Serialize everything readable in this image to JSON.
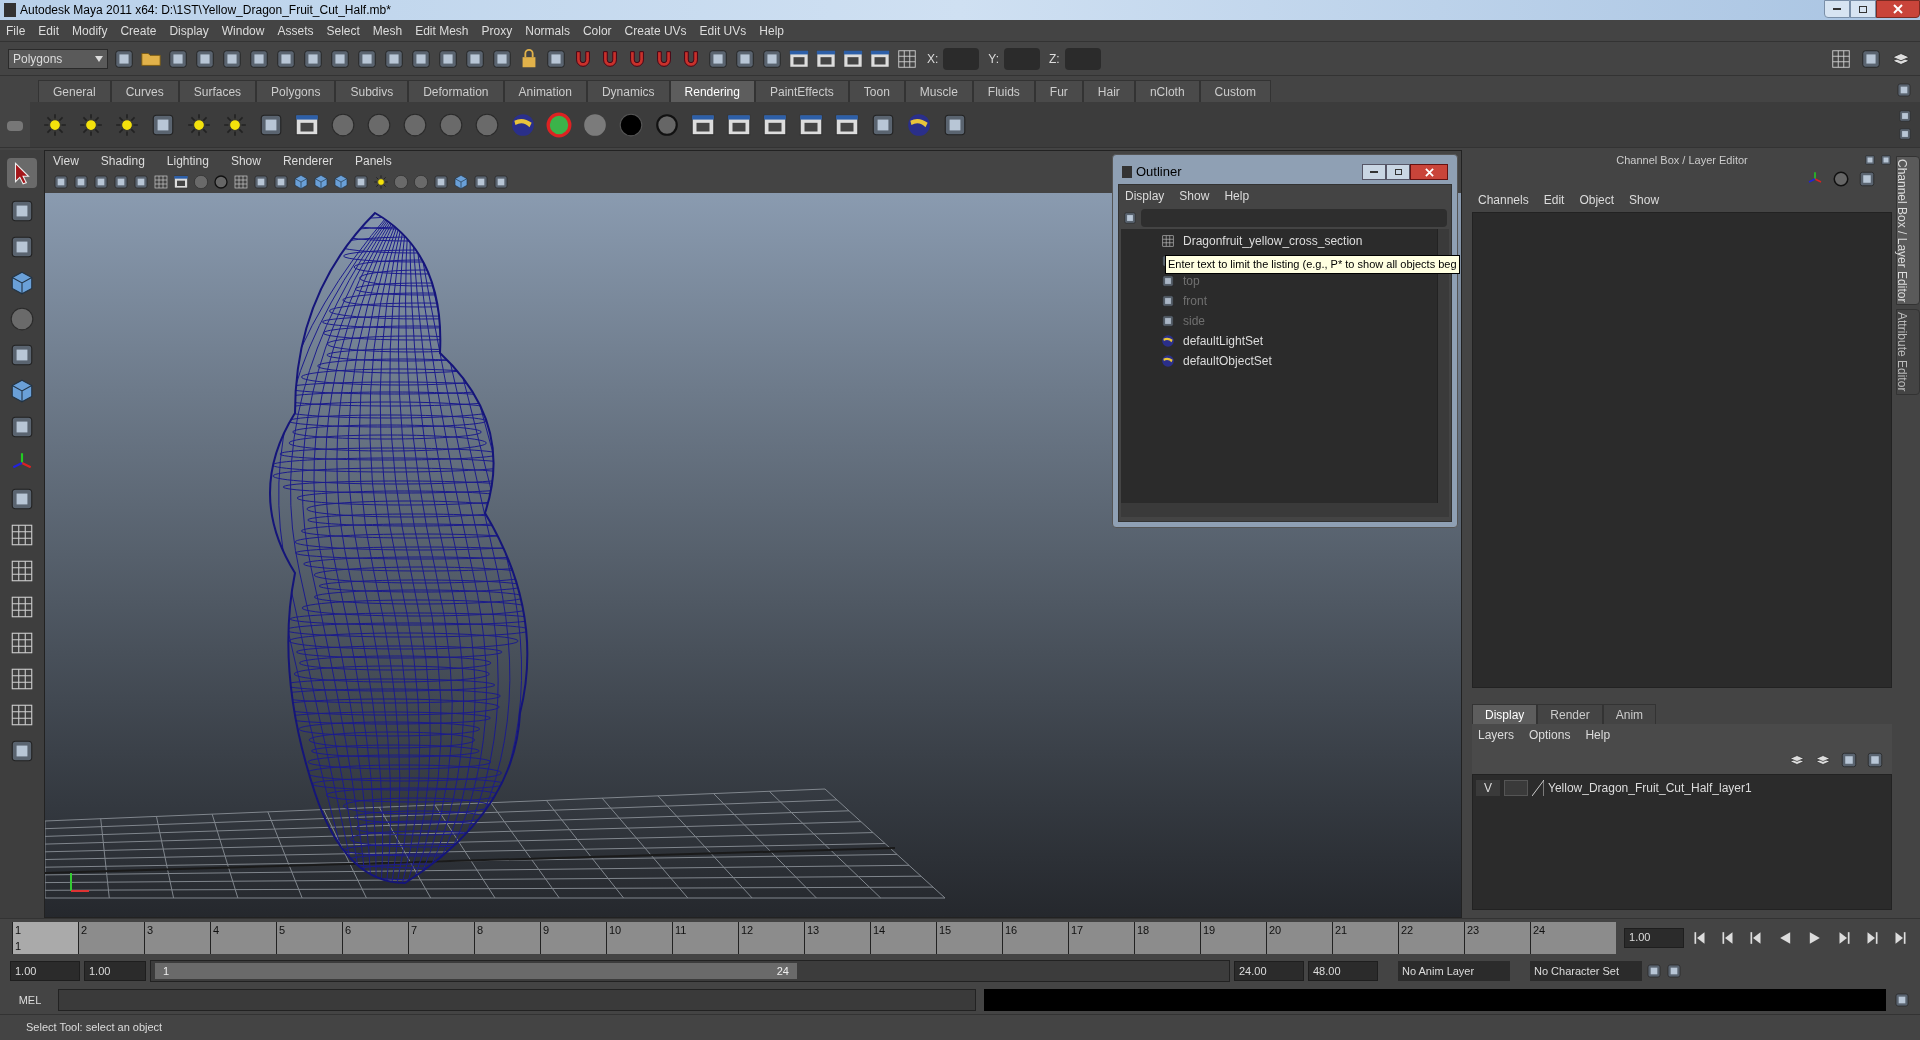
{
  "window": {
    "title": "Autodesk Maya 2011 x64: D:\\1ST\\Yellow_Dragon_Fruit_Cut_Half.mb*"
  },
  "menu_bar": [
    "File",
    "Edit",
    "Modify",
    "Create",
    "Display",
    "Window",
    "Assets",
    "Select",
    "Mesh",
    "Edit Mesh",
    "Proxy",
    "Normals",
    "Color",
    "Create UVs",
    "Edit UVs",
    "Help"
  ],
  "status_line": {
    "mode": "Polygons",
    "coords": [
      "X:",
      "Y:",
      "Z:"
    ]
  },
  "shelf": {
    "tabs": [
      {
        "label": "General",
        "selected": false
      },
      {
        "label": "Curves",
        "selected": false
      },
      {
        "label": "Surfaces",
        "selected": false
      },
      {
        "label": "Polygons",
        "selected": false
      },
      {
        "label": "Subdivs",
        "selected": false
      },
      {
        "label": "Deformation",
        "selected": false
      },
      {
        "label": "Animation",
        "selected": false
      },
      {
        "label": "Dynamics",
        "selected": false
      },
      {
        "label": "Rendering",
        "selected": true
      },
      {
        "label": "PaintEffects",
        "selected": false
      },
      {
        "label": "Toon",
        "selected": false
      },
      {
        "label": "Muscle",
        "selected": false
      },
      {
        "label": "Fluids",
        "selected": false
      },
      {
        "label": "Fur",
        "selected": false
      },
      {
        "label": "Hair",
        "selected": false
      },
      {
        "label": "nCloth",
        "selected": false
      },
      {
        "label": "Custom",
        "selected": false
      }
    ]
  },
  "viewport": {
    "menu": [
      "View",
      "Shading",
      "Lighting",
      "Show",
      "Renderer",
      "Panels"
    ]
  },
  "outliner": {
    "title": "Outliner",
    "menu": [
      "Display",
      "Show",
      "Help"
    ],
    "tooltip": "Enter text to limit the listing (e.g., P* to show all objects beg",
    "items": [
      {
        "name": "Dragonfruit_yellow_cross_section",
        "kind": "mesh",
        "dimmed": false
      },
      {
        "kind": "camera"
      },
      {
        "name": "top",
        "kind": "camera",
        "dimmed": true
      },
      {
        "name": "front",
        "kind": "camera",
        "dimmed": true
      },
      {
        "name": "side",
        "kind": "camera",
        "dimmed": true
      },
      {
        "name": "defaultLightSet",
        "kind": "set",
        "dimmed": false
      },
      {
        "name": "defaultObjectSet",
        "kind": "set",
        "dimmed": false
      }
    ]
  },
  "channel_box": {
    "title": "Channel Box / Layer Editor",
    "menu": [
      "Channels",
      "Edit",
      "Object",
      "Show"
    ],
    "side_tabs": [
      {
        "label": "Channel Box / Layer Editor",
        "selected": true
      },
      {
        "label": "Attribute Editor",
        "selected": false
      }
    ],
    "layer_tabs": [
      {
        "label": "Display",
        "selected": true
      },
      {
        "label": "Render",
        "selected": false
      },
      {
        "label": "Anim",
        "selected": false
      }
    ],
    "layer_menu": [
      "Layers",
      "Options",
      "Help"
    ],
    "layers": [
      {
        "visibility": "V",
        "template": false,
        "name": "Yellow_Dragon_Fruit_Cut_Half_layer1"
      }
    ]
  },
  "timeline": {
    "frames": [
      {
        "label": "1",
        "selected": true
      },
      {
        "label": "2",
        "selected": false
      },
      {
        "label": "3",
        "selected": false
      },
      {
        "label": "4",
        "selected": false
      },
      {
        "label": "5",
        "selected": false
      },
      {
        "label": "6",
        "selected": false
      },
      {
        "label": "7",
        "selected": false
      },
      {
        "label": "8",
        "selected": false
      },
      {
        "label": "9",
        "selected": false
      },
      {
        "label": "10",
        "selected": false
      },
      {
        "label": "11",
        "selected": false
      },
      {
        "label": "12",
        "selected": false
      },
      {
        "label": "13",
        "selected": false
      },
      {
        "label": "14",
        "selected": false
      },
      {
        "label": "15",
        "selected": false
      },
      {
        "label": "16",
        "selected": false
      },
      {
        "label": "17",
        "selected": false
      },
      {
        "label": "18",
        "selected": false
      },
      {
        "label": "19",
        "selected": false
      },
      {
        "label": "20",
        "selected": false
      },
      {
        "label": "21",
        "selected": false
      },
      {
        "label": "22",
        "selected": false
      },
      {
        "label": "23",
        "selected": false
      },
      {
        "label": "24",
        "selected": false
      }
    ],
    "current_frame": "1",
    "current_time": "1.00"
  },
  "range": {
    "start": "1.00",
    "playback_start": "1.00",
    "slider_start": "1",
    "slider_end": "24",
    "playback_end": "24.00",
    "end": "48.00",
    "level": 0.6,
    "anim_layer": "No Anim Layer",
    "character_set": "No Character Set"
  },
  "command_line": {
    "language": "MEL"
  },
  "help_line": "Select Tool: select an object"
}
